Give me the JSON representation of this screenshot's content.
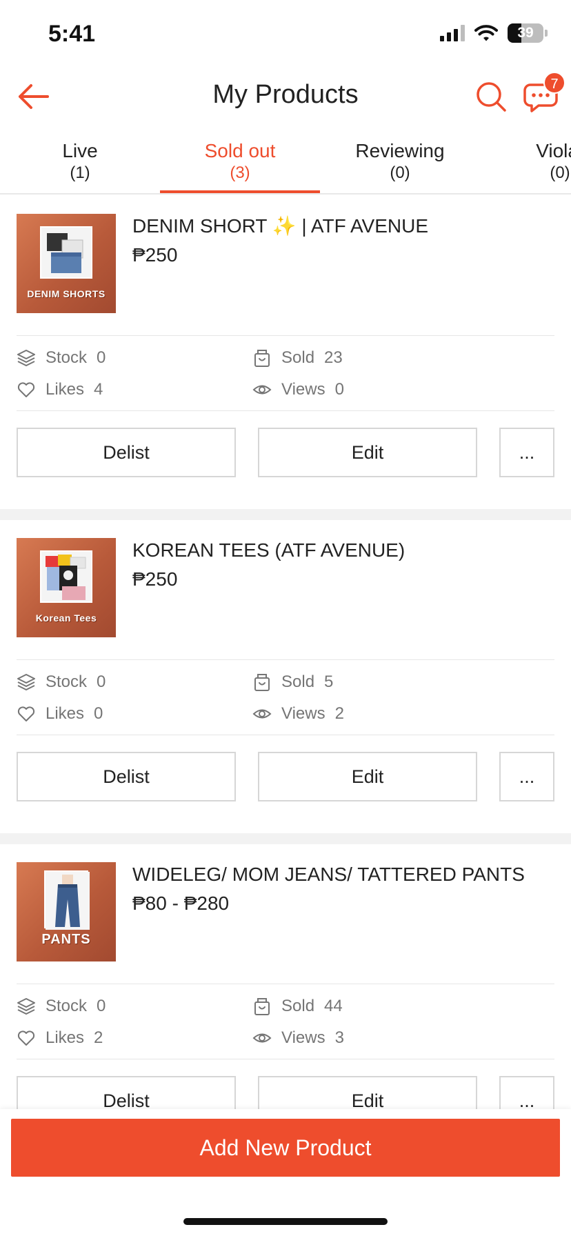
{
  "status_bar": {
    "time": "5:41",
    "battery": "39",
    "battery_level": 0.39
  },
  "header": {
    "title": "My Products",
    "chat_badge": "7"
  },
  "tabs": [
    {
      "label": "Live",
      "count": "(1)",
      "active": false
    },
    {
      "label": "Sold out",
      "count": "(3)",
      "active": true
    },
    {
      "label": "Reviewing",
      "count": "(0)",
      "active": false
    },
    {
      "label": "Violat",
      "count": "(0)",
      "active": false
    }
  ],
  "products": [
    {
      "name": "DENIM SHORT ✨ | ATF AVENUE",
      "price": "₱250",
      "thumb_caption": "DENIM SHORTS",
      "stock_label": "Stock",
      "stock": "0",
      "sold_label": "Sold",
      "sold": "23",
      "likes_label": "Likes",
      "likes": "4",
      "views_label": "Views",
      "views": "0"
    },
    {
      "name": "KOREAN TEES (ATF AVENUE)",
      "price": "₱250",
      "thumb_caption": "Korean Tees",
      "stock_label": "Stock",
      "stock": "0",
      "sold_label": "Sold",
      "sold": "5",
      "likes_label": "Likes",
      "likes": "0",
      "views_label": "Views",
      "views": "2"
    },
    {
      "name": "WIDELEG/ MOM JEANS/ TATTERED PANTS",
      "price": "₱80 - ₱280",
      "thumb_caption": "PANTS",
      "stock_label": "Stock",
      "stock": "0",
      "sold_label": "Sold",
      "sold": "44",
      "likes_label": "Likes",
      "likes": "2",
      "views_label": "Views",
      "views": "3"
    }
  ],
  "actions": {
    "delist": "Delist",
    "edit": "Edit",
    "more": "..."
  },
  "bottom": {
    "add_label": "Add New Product"
  },
  "colors": {
    "accent": "#ee4d2d",
    "muted_text": "#757575",
    "divider": "#e6e6e6"
  }
}
